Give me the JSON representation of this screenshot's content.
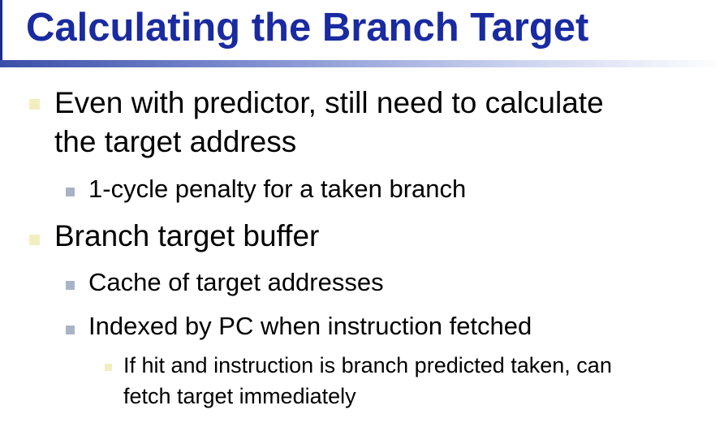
{
  "slide": {
    "title": "Calculating the Branch Target",
    "bullets": [
      {
        "level": 1,
        "lines": [
          "Even with predictor, still need to calculate",
          "the target address"
        ]
      },
      {
        "level": 2,
        "lines": [
          "1-cycle penalty for a taken branch"
        ]
      },
      {
        "level": 1,
        "lines": [
          "Branch target buffer"
        ]
      },
      {
        "level": 2,
        "lines": [
          "Cache of target addresses"
        ]
      },
      {
        "level": 2,
        "lines": [
          "Indexed by PC when instruction fetched"
        ]
      },
      {
        "level": 3,
        "lines": [
          "If hit and instruction is branch predicted taken, can",
          "fetch target immediately"
        ]
      }
    ]
  },
  "colors": {
    "title": "#1a2aa0",
    "marker_level1": "#f2eec0",
    "marker_level2": "#a9b3c7",
    "marker_level3": "#f2eec0"
  }
}
